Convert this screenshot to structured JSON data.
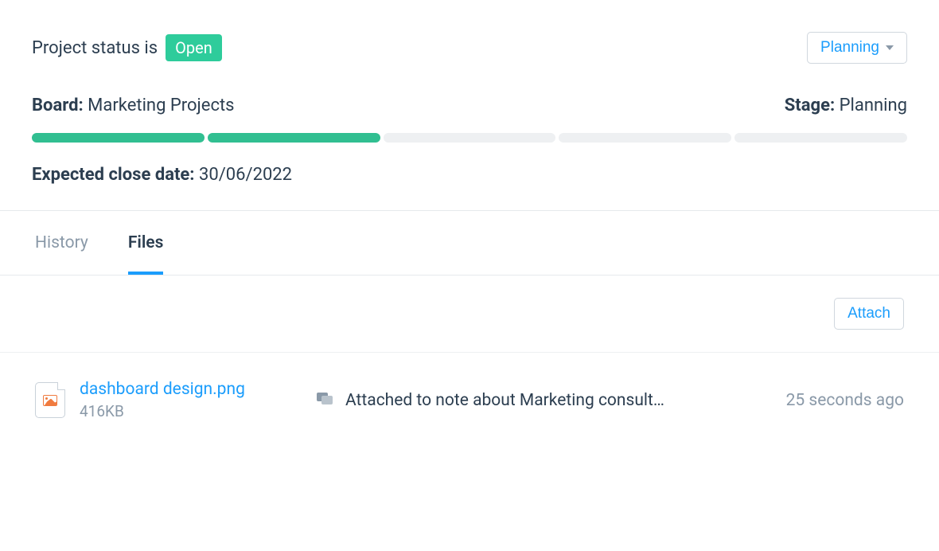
{
  "status": {
    "prefix": "Project status is",
    "badge": "Open",
    "dropdown_label": "Planning"
  },
  "board": {
    "label": "Board:",
    "value": "Marketing Projects"
  },
  "stage": {
    "label": "Stage:",
    "value": "Planning"
  },
  "progress": {
    "total": 5,
    "filled": 2
  },
  "close_date": {
    "label": "Expected close date:",
    "value": "30/06/2022"
  },
  "tabs": {
    "history": "History",
    "files": "Files"
  },
  "attach_button": "Attach",
  "file": {
    "name": "dashboard design.png",
    "size": "416KB",
    "note": "Attached to note about Marketing consult…",
    "time": "25 seconds ago"
  }
}
